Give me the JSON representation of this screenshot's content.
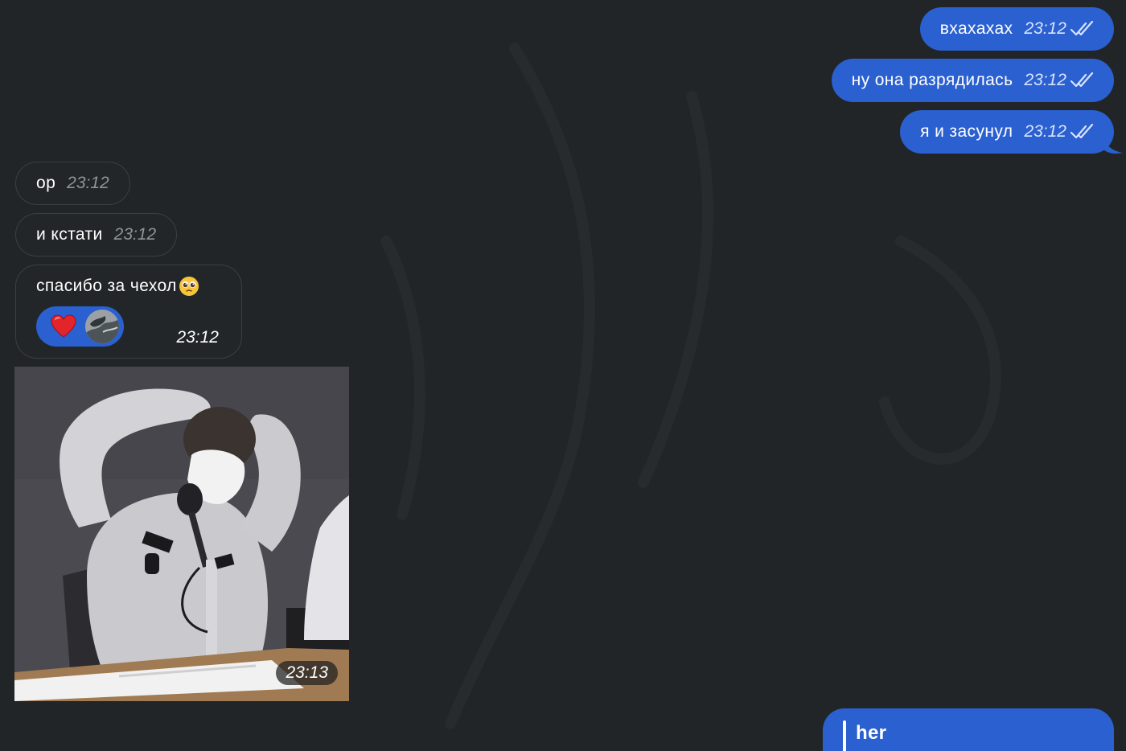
{
  "outgoing": [
    {
      "text": "вхахахах",
      "time": "23:12",
      "status_icon": "double-check-icon"
    },
    {
      "text": "ну она разрядилась",
      "time": "23:12",
      "status_icon": "double-check-icon"
    },
    {
      "text": "я и засунул",
      "time": "23:12",
      "status_icon": "double-check-icon"
    }
  ],
  "incoming": [
    {
      "text": "ор",
      "time": "23:12"
    },
    {
      "text": "и кстати",
      "time": "23:12"
    },
    {
      "text": "спасибо за чехол",
      "time": "23:12",
      "emoji": "pleading-face-emoji",
      "reaction": {
        "emoji": "red-heart-emoji",
        "avatar": "reactor-avatar"
      }
    }
  ],
  "media_message": {
    "time": "23:13",
    "content": "gif-person-at-microphone"
  },
  "reply_preview": {
    "name": "her"
  },
  "colors": {
    "background": "#222527",
    "outgoing_bubble": "#2a60cf",
    "incoming_bubble": "#222628",
    "incoming_border": "#3b3f42",
    "incoming_time": "#8e9499"
  }
}
